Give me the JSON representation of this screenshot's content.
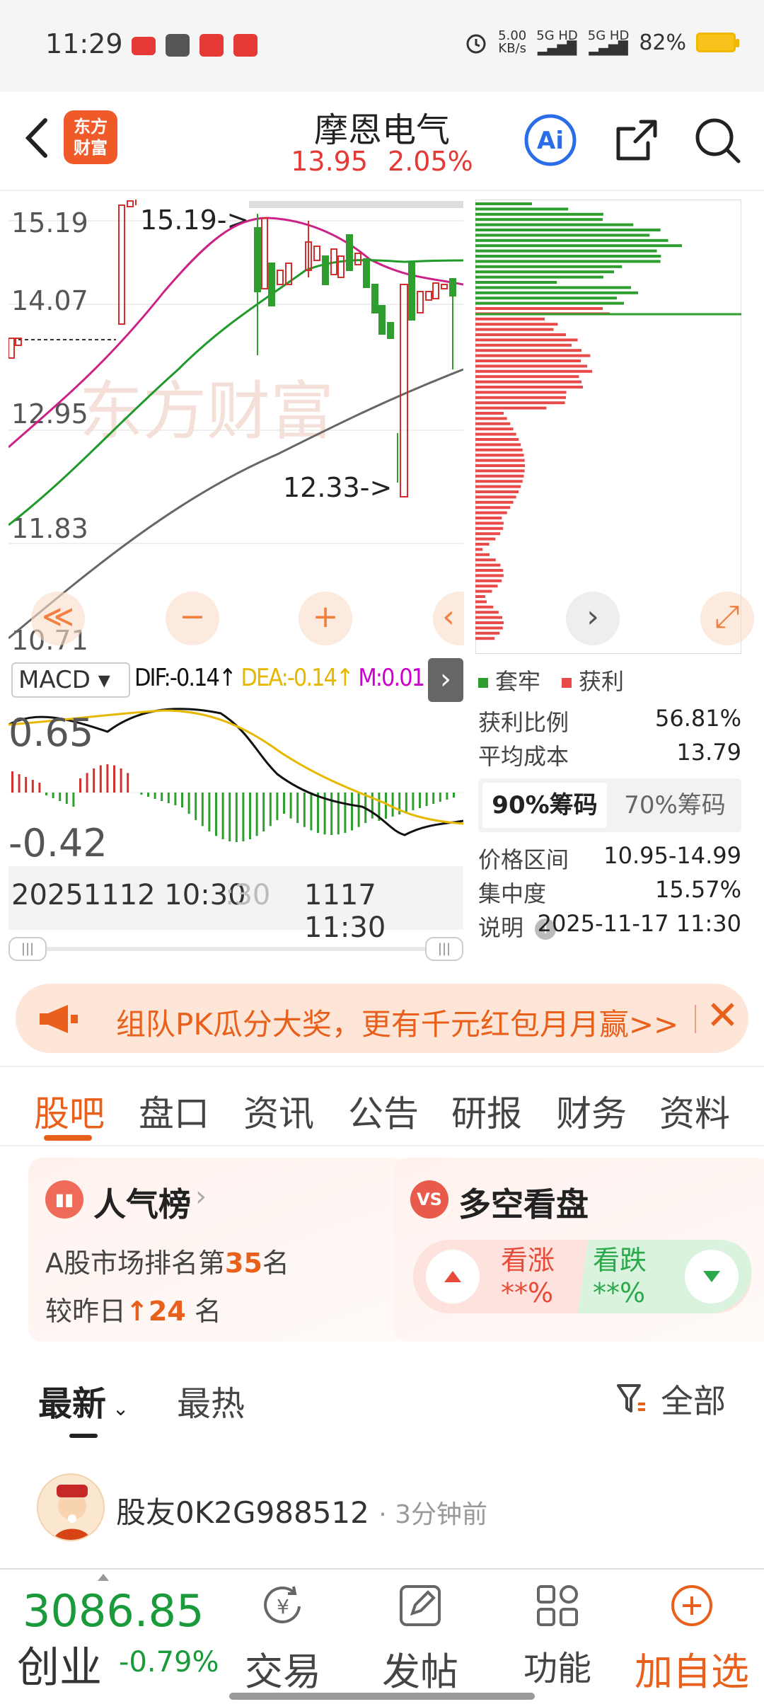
{
  "status": {
    "time": "11:29",
    "net_speed": "5.00",
    "net_unit": "KB/s",
    "sig1": "5G HD",
    "sig2": "5G HD",
    "battery": "82%"
  },
  "header": {
    "logo_line1": "东方",
    "logo_line2": "财富",
    "name": "摩恩电气",
    "price": "13.95",
    "change": "2.05%"
  },
  "kline": {
    "y_ticks": [
      "15.19",
      "14.07",
      "12.95",
      "11.83",
      "10.71"
    ],
    "high_label": "15.19->",
    "low_label": "12.33->",
    "watermark": "东方财富",
    "btn_first": "≪",
    "btn_minus": "−",
    "btn_plus": "+",
    "btn_left": "‹",
    "btn_right": "›",
    "btn_expand": "⤢"
  },
  "macd": {
    "selector": "MACD",
    "dif": "DIF:-0.14↑",
    "dea": "DEA:-0.14↑",
    "m": "M:0.01↑",
    "more": "›",
    "y_top": "0.65",
    "y_bottom": "-0.42",
    "colors": {
      "dif": "#111111",
      "dea": "#e6b800",
      "m": "#cc00cc",
      "up": "#d32f2f",
      "down": "#2e9e2e"
    }
  },
  "time_axis": {
    "left": "20251112 10:30",
    "left_faded": ":30",
    "right": "1117 11:30"
  },
  "chips": {
    "legend_trapped": "套牢",
    "legend_profit": "获利",
    "profit_ratio_label": "获利比例",
    "profit_ratio": "56.81%",
    "avg_cost_label": "平均成本",
    "avg_cost": "13.79",
    "tab_90": "90%筹码",
    "tab_70": "70%筹码",
    "price_range_label": "价格区间",
    "price_range": "10.95-14.99",
    "concentration_label": "集中度",
    "concentration": "15.57%",
    "note_label": "说明",
    "note_value": "2025-11-17 11:30"
  },
  "banner": {
    "text": "组队PK瓜分大奖，更有千元红包月月赢>>"
  },
  "tabs": [
    "股吧",
    "盘口",
    "资讯",
    "公告",
    "研报",
    "财务",
    "资料"
  ],
  "cards": {
    "rank_title": "人气榜",
    "rank_line1_pre": "A股市场排名第",
    "rank_num": "35",
    "rank_line1_post": "名",
    "rank_line2_pre": "较昨日",
    "rank_delta": "24",
    "rank_line2_post": "名",
    "vs_title": "多空看盘",
    "vs_up": "看涨",
    "vs_up_val": "**%",
    "vs_down": "看跌",
    "vs_down_val": "**%"
  },
  "feed": {
    "sort_new": "最新",
    "sort_hot": "最热",
    "filter": "全部",
    "post_user": "股友0K2G988512",
    "post_time": "· 3分钟前"
  },
  "bottom": {
    "index_value": "3086.85",
    "index_name": "创业",
    "index_change": "-0.79%",
    "nav": [
      "交易",
      "发帖",
      "功能",
      "加自选"
    ]
  }
}
